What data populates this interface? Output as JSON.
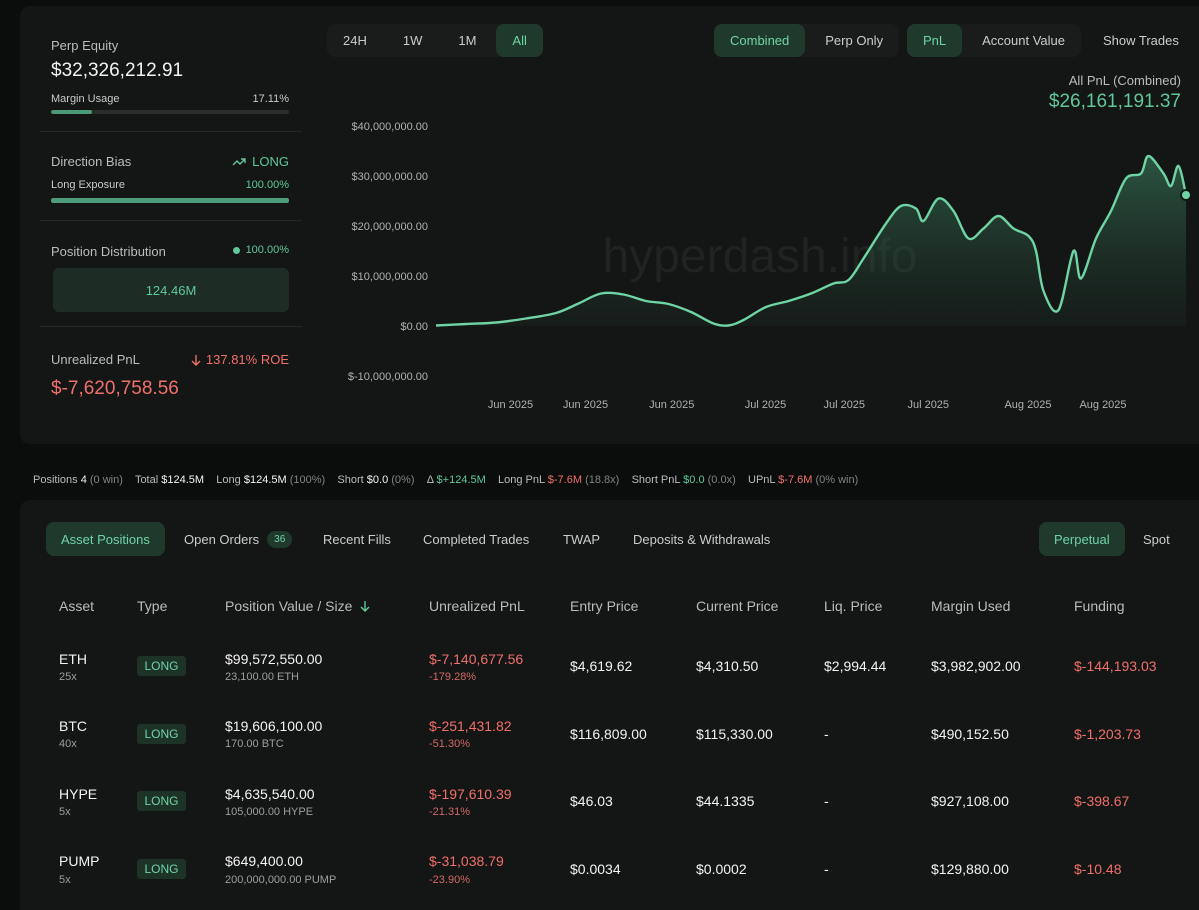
{
  "left": {
    "perp_equity_label": "Perp Equity",
    "perp_equity_value": "$32,326,212.91",
    "margin_usage_label": "Margin Usage",
    "margin_usage_value": "17.11%",
    "margin_usage_fraction": 0.1711,
    "direction_bias_label": "Direction Bias",
    "direction_bias_value": "LONG",
    "long_exposure_label": "Long Exposure",
    "long_exposure_value": "100.00%",
    "long_exposure_fraction": 1.0,
    "position_distribution_label": "Position Distribution",
    "position_distribution_value": "100.00%",
    "distribution_box": "124.46M",
    "unrealized_pnl_label": "Unrealized PnL",
    "roe_value": "137.81% ROE",
    "unrealized_pnl_value": "$-7,620,758.56"
  },
  "time_filters": [
    "24H",
    "1W",
    "1M",
    "All"
  ],
  "time_filter_active": "All",
  "view_filters": [
    "Combined",
    "Perp Only"
  ],
  "metric_filters": [
    "PnL",
    "Account Value"
  ],
  "show_trades_label": "Show Trades",
  "chart_header": {
    "title": "All PnL (Combined)",
    "total": "$26,161,191.37"
  },
  "chart_data": {
    "type": "area",
    "watermark": "hyperdash.info",
    "y_ticks": [
      "$40,000,000.00",
      "$30,000,000.00",
      "$20,000,000.00",
      "$10,000,000.00",
      "$0.00",
      "$-10,000,000.00"
    ],
    "y_tick_values": [
      40000000,
      30000000,
      20000000,
      10000000,
      0,
      -10000000
    ],
    "ylim": [
      -10000000,
      40000000
    ],
    "x_ticks": [
      "Jun 2025",
      "Jun 2025",
      "Jun 2025",
      "Jul 2025",
      "Jul 2025",
      "Jul 2025",
      "Aug 2025",
      "Aug 2025"
    ],
    "x_tick_positions": [
      0.11,
      0.21,
      0.325,
      0.45,
      0.555,
      0.667,
      0.8,
      0.9
    ],
    "series_color": "#6fd4a4",
    "points": [
      [
        0,
        0.1
      ],
      [
        0.04,
        0.4
      ],
      [
        0.08,
        0.7
      ],
      [
        0.12,
        1.5
      ],
      [
        0.16,
        2.6
      ],
      [
        0.19,
        4.5
      ],
      [
        0.22,
        6.5
      ],
      [
        0.25,
        6.3
      ],
      [
        0.28,
        5.0
      ],
      [
        0.31,
        4.4
      ],
      [
        0.34,
        2.8
      ],
      [
        0.37,
        0.5
      ],
      [
        0.39,
        0.1
      ],
      [
        0.41,
        1.2
      ],
      [
        0.44,
        3.8
      ],
      [
        0.47,
        5.0
      ],
      [
        0.5,
        6.5
      ],
      [
        0.53,
        8.5
      ],
      [
        0.55,
        9.2
      ],
      [
        0.57,
        13.5
      ],
      [
        0.6,
        20.5
      ],
      [
        0.62,
        24.0
      ],
      [
        0.64,
        23.5
      ],
      [
        0.65,
        21.0
      ],
      [
        0.67,
        25.5
      ],
      [
        0.69,
        23.0
      ],
      [
        0.71,
        17.5
      ],
      [
        0.73,
        19.5
      ],
      [
        0.75,
        22.0
      ],
      [
        0.77,
        19.5
      ],
      [
        0.79,
        18.0
      ],
      [
        0.8,
        15.0
      ],
      [
        0.81,
        7.0
      ],
      [
        0.83,
        3.2
      ],
      [
        0.85,
        15.0
      ],
      [
        0.86,
        9.5
      ],
      [
        0.88,
        17.5
      ],
      [
        0.9,
        23.0
      ],
      [
        0.92,
        29.5
      ],
      [
        0.94,
        30.5
      ],
      [
        0.95,
        34.0
      ],
      [
        0.97,
        30.5
      ],
      [
        0.98,
        28.0
      ],
      [
        0.99,
        32.0
      ],
      [
        1.0,
        26.2
      ]
    ]
  },
  "summary": {
    "positions_label": "Positions",
    "positions_value": "4",
    "positions_win": "(0 win)",
    "total_label": "Total",
    "total_value": "$124.5M",
    "long_label": "Long",
    "long_value": "$124.5M",
    "long_pct": "(100%)",
    "short_label": "Short",
    "short_value": "$0.0",
    "short_pct": "(0%)",
    "delta_symbol": "Δ",
    "delta_value": "$+124.5M",
    "long_pnl_label": "Long PnL",
    "long_pnl_value": "$-7.6M",
    "long_pnl_x": "(18.8x)",
    "short_pnl_label": "Short PnL",
    "short_pnl_value": "$0.0",
    "short_pnl_x": "(0.0x)",
    "upnl_label": "UPnL",
    "upnl_value": "$-7.6M",
    "upnl_win": "(0% win)"
  },
  "tabs": [
    {
      "label": "Asset Positions"
    },
    {
      "label": "Open Orders",
      "badge": "36"
    },
    {
      "label": "Recent Fills"
    },
    {
      "label": "Completed Trades"
    },
    {
      "label": "TWAP"
    },
    {
      "label": "Deposits & Withdrawals"
    }
  ],
  "market_tabs": [
    "Perpetual",
    "Spot"
  ],
  "table": {
    "headers": [
      "Asset",
      "Type",
      "Position Value / Size",
      "Unrealized PnL",
      "Entry Price",
      "Current Price",
      "Liq. Price",
      "Margin Used",
      "Funding"
    ],
    "rows": [
      {
        "asset": "ETH",
        "leverage": "25x",
        "type": "LONG",
        "value": "$99,572,550.00",
        "size": "23,100.00 ETH",
        "upnl": "$-7,140,677.56",
        "upnl_pct": "-179.28%",
        "entry": "$4,619.62",
        "current": "$4,310.50",
        "liq": "$2,994.44",
        "margin": "$3,982,902.00",
        "funding": "$-144,193.03"
      },
      {
        "asset": "BTC",
        "leverage": "40x",
        "type": "LONG",
        "value": "$19,606,100.00",
        "size": "170.00 BTC",
        "upnl": "$-251,431.82",
        "upnl_pct": "-51.30%",
        "entry": "$116,809.00",
        "current": "$115,330.00",
        "liq": "-",
        "margin": "$490,152.50",
        "funding": "$-1,203.73"
      },
      {
        "asset": "HYPE",
        "leverage": "5x",
        "type": "LONG",
        "value": "$4,635,540.00",
        "size": "105,000.00 HYPE",
        "upnl": "$-197,610.39",
        "upnl_pct": "-21.31%",
        "entry": "$46.03",
        "current": "$44.1335",
        "liq": "-",
        "margin": "$927,108.00",
        "funding": "$-398.67"
      },
      {
        "asset": "PUMP",
        "leverage": "5x",
        "type": "LONG",
        "value": "$649,400.00",
        "size": "200,000,000.00 PUMP",
        "upnl": "$-31,038.79",
        "upnl_pct": "-23.90%",
        "entry": "$0.0034",
        "current": "$0.0002",
        "liq": "-",
        "margin": "$129,880.00",
        "funding": "$-10.48"
      }
    ]
  }
}
